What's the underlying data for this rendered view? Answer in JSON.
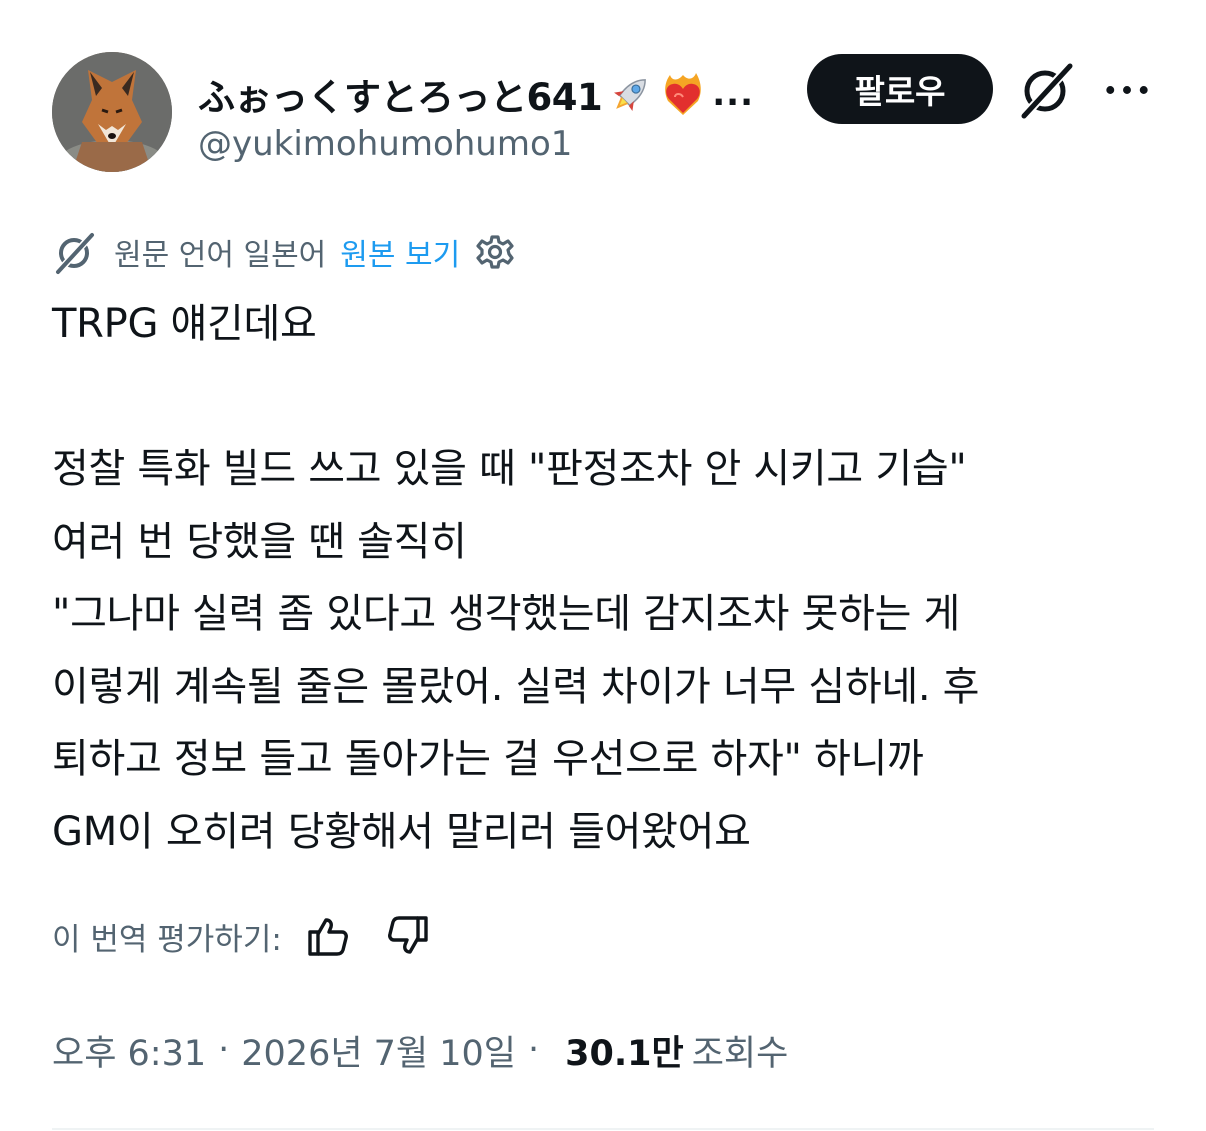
{
  "author": {
    "display_name": "ふぉっくすとろっと641",
    "name_ellipsis": "...",
    "handle": "@yukimohumohumo1",
    "avatar_icon": "fox-photo-avatar",
    "name_emojis": [
      "rocket-emoji",
      "heart-on-fire-emoji"
    ]
  },
  "actions": {
    "follow_label": "팔로우",
    "grok_icon": "grok-icon",
    "more_label": "..."
  },
  "translation": {
    "icon": "grok-icon",
    "language_label": "원문 언어 일본어",
    "show_original_label": "원본 보기",
    "settings_icon": "gear-icon"
  },
  "tweet": {
    "lines": [
      "TRPG 얘긴데요",
      "",
      "정찰 특화 빌드 쓰고 있을 때 \"판정조차 안 시키고 기습\"",
      "여러 번 당했을 땐 솔직히",
      "\"그나마 실력 좀 있다고 생각했는데 감지조차 못하는 게",
      "이렇게 계속될 줄은 몰랐어. 실력 차이가 너무 심하네. 후",
      "퇴하고 정보 들고 돌아가는 걸 우선으로 하자\" 하니까",
      "GM이 오히려 당황해서 말리러 들어왔어요"
    ]
  },
  "rating": {
    "label": "이 번역 평가하기:",
    "thumbs_up_icon": "thumbs-up-icon",
    "thumbs_down_icon": "thumbs-down-icon"
  },
  "meta": {
    "time": "오후 6:31",
    "separator": "·",
    "date": "2026년 7월 10일",
    "views_count": "30.1만",
    "views_label": "조회수"
  },
  "colors": {
    "text_primary": "#0f1419",
    "text_secondary": "#536471",
    "link": "#1d9bf0",
    "button_bg": "#0f1419",
    "button_text": "#ffffff",
    "divider": "#eff3f4"
  }
}
